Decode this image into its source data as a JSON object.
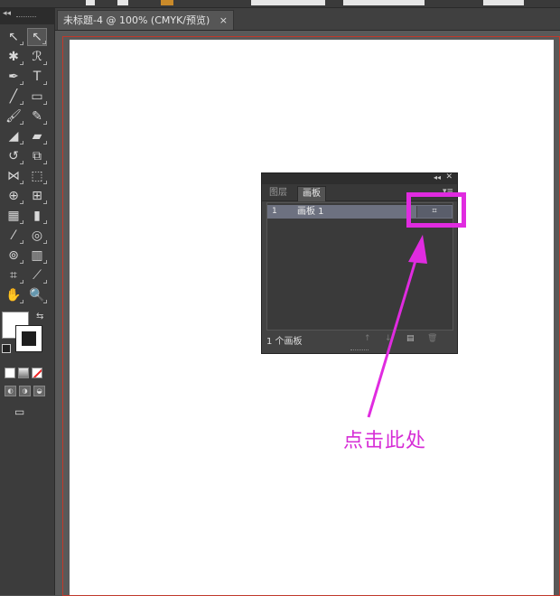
{
  "document_tab": {
    "title": "未标题-4 @ 100% (CMYK/预览)",
    "close_symbol": "×"
  },
  "toolbar": {
    "collapse_symbol": "◂◂",
    "rows": [
      [
        {
          "icon": "selection-tool-icon",
          "glyph": "↖",
          "selected": false
        },
        {
          "icon": "direct-selection-tool-icon",
          "glyph": "↖",
          "selected": true
        }
      ],
      [
        {
          "icon": "magic-wand-tool-icon",
          "glyph": "✱",
          "selected": false
        },
        {
          "icon": "lasso-tool-icon",
          "glyph": "ℛ",
          "selected": false
        }
      ],
      [
        {
          "icon": "pen-tool-icon",
          "glyph": "✒",
          "selected": false
        },
        {
          "icon": "type-tool-icon",
          "glyph": "T",
          "selected": false
        }
      ],
      [
        {
          "icon": "line-tool-icon",
          "glyph": "╱",
          "selected": false
        },
        {
          "icon": "rectangle-tool-icon",
          "glyph": "▭",
          "selected": false
        }
      ],
      [
        {
          "icon": "paintbrush-tool-icon",
          "glyph": "🖌",
          "selected": false
        },
        {
          "icon": "pencil-tool-icon",
          "glyph": "✎",
          "selected": false
        }
      ],
      [
        {
          "icon": "blob-brush-tool-icon",
          "glyph": "◢",
          "selected": false
        },
        {
          "icon": "eraser-tool-icon",
          "glyph": "▰",
          "selected": false
        }
      ],
      [
        {
          "icon": "rotate-tool-icon",
          "glyph": "↺",
          "selected": false
        },
        {
          "icon": "scale-tool-icon",
          "glyph": "⧉",
          "selected": false
        }
      ],
      [
        {
          "icon": "width-tool-icon",
          "glyph": "⋈",
          "selected": false
        },
        {
          "icon": "free-transform-tool-icon",
          "glyph": "⬚",
          "selected": false
        }
      ],
      [
        {
          "icon": "shape-builder-tool-icon",
          "glyph": "⊕",
          "selected": false
        },
        {
          "icon": "perspective-grid-tool-icon",
          "glyph": "⊞",
          "selected": false
        }
      ],
      [
        {
          "icon": "mesh-tool-icon",
          "glyph": "▦",
          "selected": false
        },
        {
          "icon": "gradient-tool-icon",
          "glyph": "▮",
          "selected": false
        }
      ],
      [
        {
          "icon": "eyedropper-tool-icon",
          "glyph": "⁄",
          "selected": false
        },
        {
          "icon": "blend-tool-icon",
          "glyph": "◎",
          "selected": false
        }
      ],
      [
        {
          "icon": "symbol-sprayer-tool-icon",
          "glyph": "⊚",
          "selected": false
        },
        {
          "icon": "column-graph-tool-icon",
          "glyph": "▥",
          "selected": false
        }
      ],
      [
        {
          "icon": "artboard-tool-icon",
          "glyph": "⌗",
          "selected": false
        },
        {
          "icon": "slice-tool-icon",
          "glyph": "⟋",
          "selected": false
        }
      ],
      [
        {
          "icon": "hand-tool-icon",
          "glyph": "✋",
          "selected": false
        },
        {
          "icon": "zoom-tool-icon",
          "glyph": "🔍",
          "selected": false
        }
      ]
    ],
    "swap_symbol": "⇆",
    "draw_modes": [
      "◐",
      "◑",
      "◒"
    ],
    "screen_mode_symbol": "▭"
  },
  "panel": {
    "collapse_symbol": "◂◂",
    "close_symbol": "✕",
    "tab_layers": "图层",
    "tab_artboards": "画板",
    "menu_symbol": "▾≡",
    "row": {
      "number": "1",
      "name": "画板 1",
      "options_symbol": "⌗"
    },
    "footer_count": "1 个画板",
    "footer_icons": [
      "↑",
      "↓",
      "▤",
      "🗑"
    ]
  },
  "annotation": {
    "text": "点击此处",
    "color": "#e02be0"
  }
}
